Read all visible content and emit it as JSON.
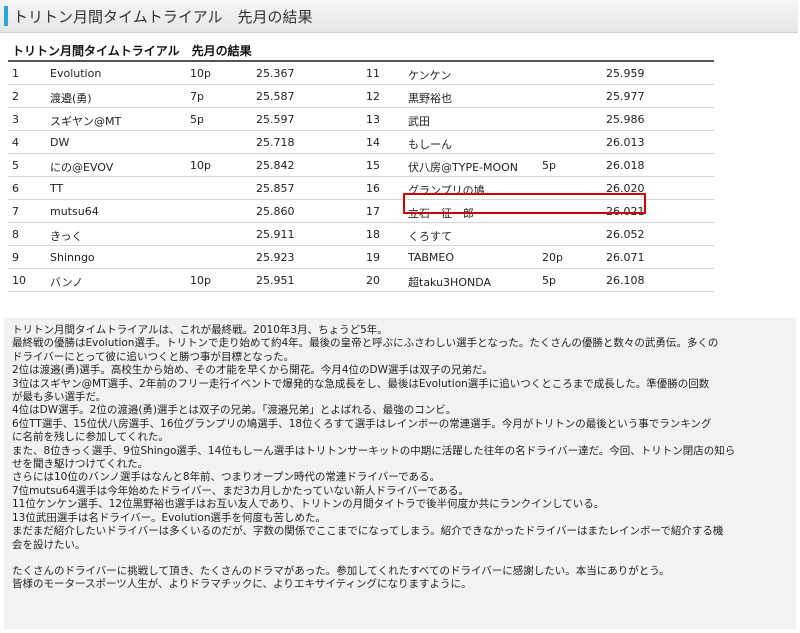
{
  "header": {
    "title": "トリトン月間タイムトライアル　先月の結果"
  },
  "results": {
    "heading": "トリトン月間タイムトライアル　先月の結果",
    "left": [
      {
        "rank": "1",
        "name": "Evolution",
        "points": "10p",
        "time": "25.367"
      },
      {
        "rank": "2",
        "name": "渡邉(勇)",
        "points": "7p",
        "time": "25.587"
      },
      {
        "rank": "3",
        "name": "スギヤン@MT",
        "points": "5p",
        "time": "25.597"
      },
      {
        "rank": "4",
        "name": "DW",
        "points": "",
        "time": "25.718"
      },
      {
        "rank": "5",
        "name": "にの@EVOV",
        "points": "10p",
        "time": "25.842"
      },
      {
        "rank": "6",
        "name": "TT",
        "points": "",
        "time": "25.857"
      },
      {
        "rank": "7",
        "name": "mutsu64",
        "points": "",
        "time": "25.860"
      },
      {
        "rank": "8",
        "name": "きっく",
        "points": "",
        "time": "25.911"
      },
      {
        "rank": "9",
        "name": "Shinngo",
        "points": "",
        "time": "25.923"
      },
      {
        "rank": "10",
        "name": "バンノ",
        "points": "10p",
        "time": "25.951"
      }
    ],
    "right": [
      {
        "rank": "11",
        "name": "ケンケン",
        "points": "",
        "time": "25.959"
      },
      {
        "rank": "12",
        "name": "黒野裕也",
        "points": "",
        "time": "25.977"
      },
      {
        "rank": "13",
        "name": "武田",
        "points": "",
        "time": "25.986"
      },
      {
        "rank": "14",
        "name": "もしーん",
        "points": "",
        "time": "26.013"
      },
      {
        "rank": "15",
        "name": "伏八房@TYPE-MOON",
        "points": "5p",
        "time": "26.018"
      },
      {
        "rank": "16",
        "name": "グランプリの鳩",
        "points": "",
        "time": "26.020"
      },
      {
        "rank": "17",
        "name": "立石　征一郎",
        "points": "",
        "time": "26.021"
      },
      {
        "rank": "18",
        "name": "くろすて",
        "points": "",
        "time": "26.052"
      },
      {
        "rank": "19",
        "name": "TABMEO",
        "points": "20p",
        "time": "26.071"
      },
      {
        "rank": "20",
        "name": "超taku3HONDA",
        "points": "5p",
        "time": "26.108"
      }
    ]
  },
  "description": {
    "lines": [
      "トリトン月間タイムトライアルは、これが最終戦。2010年3月、ちょうど5年。",
      "最終戦の優勝はEvolution選手。トリトンで走り始めて約4年。最後の皇帝と呼ぶにふさわしい選手となった。たくさんの優勝と数々の武勇伝。多くの",
      "ドライバーにとって彼に追いつくと勝つ事が目標となった。",
      "2位は渡邉(勇)選手。高校生から始め、その才能を早くから開花。今月4位のDW選手は双子の兄弟だ。",
      "3位はスギヤン@MT選手、2年前のフリー走行イベントで爆発的な急成長をし、最後はEvolution選手に追いつくところまで成長した。準優勝の回数",
      "が最も多い選手だ。",
      "4位はDW選手。2位の渡邉(勇)選手とは双子の兄弟。「渡邉兄弟」とよばれる、最強のコンビ。",
      "6位TT選手、15位伏八房選手、16位グランプリの鳩選手、18位くろすて選手はレインボーの常連選手。今月がトリトンの最後という事でランキング",
      "に名前を残しに参加してくれた。",
      "また、8位きっく選手、9位Shingo選手、14位もしーん選手はトリトンサーキットの中期に活躍した往年の名ドライバー達だ。今回、トリトン閉店の知ら",
      "せを聞き駆けつけてくれた。",
      "さらには10位のバンノ選手はなんと8年前、つまりオープン時代の常連ドライバーである。",
      "7位mutsu64選手は今年始めたドライバー、まだ3カ月しかたっていない新人ドライバーである。",
      "11位ケンケン選手、12位黒野裕也選手はお互い友人であり、トリトンの月間タイトラで後半何度か共にランクインしている。",
      "13位武田選手は名ドライバー。Evolution選手を何度も苦しめた。",
      "まだまだ紹介したいドライバーは多くいるのだが、字数の関係でここまでになってしまう。紹介できなかったドライバーはまたレインボーで紹介する機",
      "会を設けたい。",
      "",
      "たくさんのドライバーに挑戦して頂き、たくさんのドラマがあった。参加してくれたすべてのドライバーに感謝したい。本当にありがとう。",
      "皆様のモータースポーツ人生が、よりドラマチックに、よりエキサイティングになりますように。"
    ]
  }
}
